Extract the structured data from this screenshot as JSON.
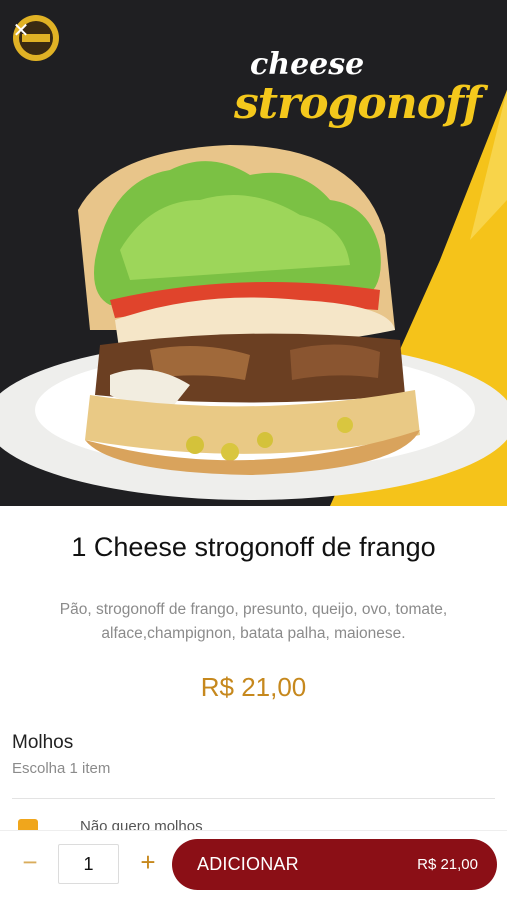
{
  "header": {
    "close_icon": "close-icon",
    "hero_title_line1": "cheese",
    "hero_title_line2": "strogonoff",
    "colors": {
      "hero_bg": "#1f1f22",
      "hero_accent": "#f4c81c"
    }
  },
  "product": {
    "name": "1 Cheese strogonoff de frango",
    "description": "Pão, strogonoff de frango, presunto, queijo, ovo, tomate, alface,champignon, batata palha, maionese.",
    "price": "R$ 21,00"
  },
  "options": {
    "title": "Molhos",
    "subtitle": "Escolha 1 item",
    "items": [
      {
        "label": "Não quero molhos",
        "checked": true
      }
    ]
  },
  "bottom_bar": {
    "minus_label": "−",
    "quantity": "1",
    "plus_label": "+",
    "add_label": "ADICIONAR",
    "add_price": "R$ 21,00",
    "colors": {
      "button": "#8b0f16",
      "accent": "#c6881d"
    }
  }
}
